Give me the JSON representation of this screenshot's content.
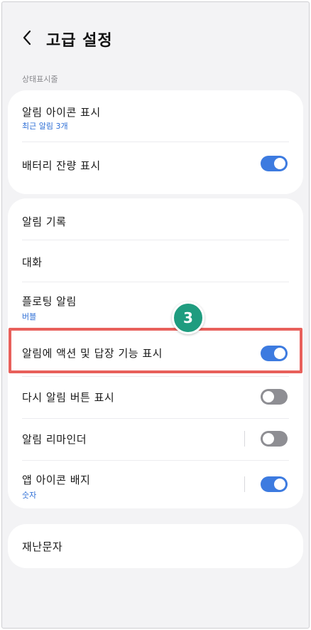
{
  "header": {
    "title": "고급 설정"
  },
  "section_label": "상태표시줄",
  "card1": {
    "notif_icons": {
      "label": "알림 아이콘 표시",
      "sub": "최근 알림 3개"
    },
    "battery": {
      "label": "배터리 잔량 표시",
      "toggle": "on"
    }
  },
  "card2": {
    "history": {
      "label": "알림 기록"
    },
    "conversation": {
      "label": "대화"
    },
    "floating": {
      "label": "플로팅 알림",
      "sub": "버블"
    },
    "actions_replies": {
      "label": "알림에 액션 및 답장 기능 표시",
      "toggle": "on"
    },
    "snooze": {
      "label": "다시 알림 버튼 표시",
      "toggle": "off"
    },
    "reminder": {
      "label": "알림 리마인더",
      "toggle": "off"
    },
    "app_badge": {
      "label": "앱 아이콘 배지",
      "sub": "숫자",
      "toggle": "on"
    }
  },
  "card3": {
    "emergency": {
      "label": "재난문자"
    }
  },
  "annotation": {
    "step_number": "3"
  },
  "colors": {
    "accent": "#3d7be0",
    "sub_text": "#2f6fd6",
    "highlight_border": "#e8605b",
    "badge": "#1f9c7f",
    "background": "#f3f3f5"
  },
  "icons": {
    "back": "chevron-left-icon"
  }
}
